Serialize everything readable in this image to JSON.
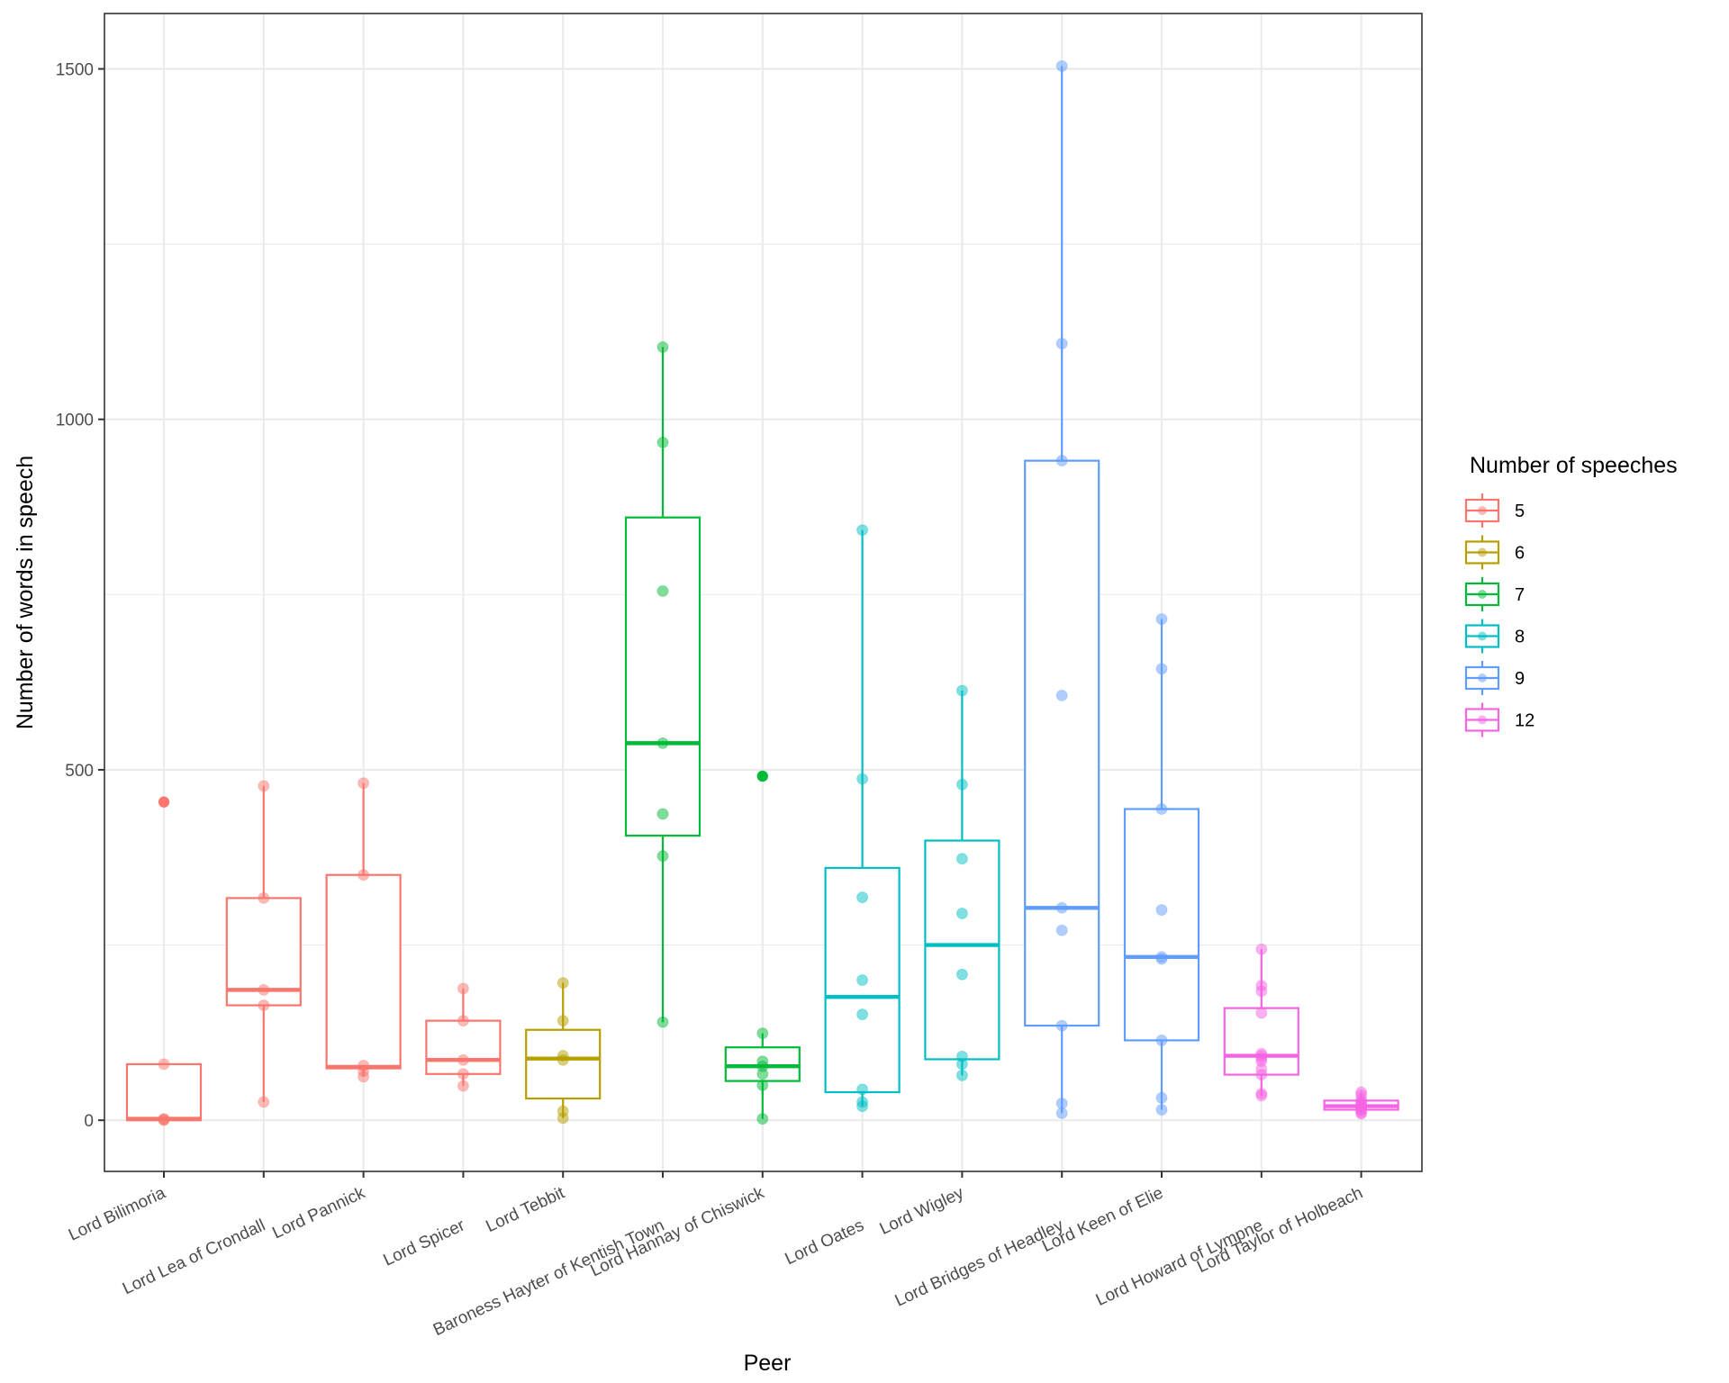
{
  "chart_data": {
    "type": "box",
    "title": "",
    "xlabel": "Peer",
    "ylabel": "Number of words in speech",
    "ylim": [
      -73,
      1579
    ],
    "y_ticks": [
      0,
      500,
      1000,
      1500
    ],
    "y_minor_ticks": [
      250,
      750,
      1250
    ],
    "grid": true,
    "legend": {
      "title": "Number of speeches",
      "placement": "right",
      "entries": [
        {
          "label": "5",
          "color": "#F8766D"
        },
        {
          "label": "6",
          "color": "#B79F00"
        },
        {
          "label": "7",
          "color": "#00BA38"
        },
        {
          "label": "8",
          "color": "#00BFC4"
        },
        {
          "label": "9",
          "color": "#619CFF"
        },
        {
          "label": "12",
          "color": "#F564E3"
        }
      ]
    },
    "categories": [
      "Lord Bilimoria",
      "Lord Lea of Crondall",
      "Lord Pannick",
      "Lord Spicer",
      "Lord Tebbit",
      "Baroness Hayter of Kentish Town",
      "Lord Hannay of Chiswick",
      "Lord Oates",
      "Lord Wigley",
      "Lord Bridges of Headley",
      "Lord Keen of Elie",
      "Lord Howard of Lympne",
      "Lord Taylor of Holbeach"
    ],
    "series": [
      {
        "peer": "Lord Bilimoria",
        "group": "5",
        "min": 0,
        "q1": 0,
        "median": 2,
        "q3": 80,
        "max": 80,
        "outliers": [
          454
        ],
        "points": [
          80,
          2,
          1,
          0,
          454
        ]
      },
      {
        "peer": "Lord Lea of Crondall",
        "group": "5",
        "min": 26,
        "q1": 164,
        "median": 186,
        "q3": 317,
        "max": 477,
        "outliers": [],
        "points": [
          477,
          317,
          186,
          164,
          26
        ]
      },
      {
        "peer": "Lord Pannick",
        "group": "5",
        "min": 62,
        "q1": 74,
        "median": 76,
        "q3": 350,
        "max": 481,
        "outliers": [],
        "points": [
          481,
          350,
          78,
          70,
          62
        ]
      },
      {
        "peer": "Lord Spicer",
        "group": "5",
        "min": 49,
        "q1": 66,
        "median": 86,
        "q3": 142,
        "max": 188,
        "outliers": [],
        "points": [
          188,
          142,
          86,
          66,
          49
        ]
      },
      {
        "peer": "Lord Tebbit",
        "group": "6",
        "min": 3,
        "q1": 31,
        "median": 88,
        "q3": 129,
        "max": 196,
        "outliers": [],
        "points": [
          196,
          142,
          92,
          86,
          13,
          3
        ]
      },
      {
        "peer": "Baroness Hayter of Kentish Town",
        "group": "7",
        "min": 140,
        "q1": 406,
        "median": 538,
        "q3": 860,
        "max": 1103,
        "outliers": [],
        "points": [
          1103,
          967,
          755,
          538,
          437,
          377,
          140
        ]
      },
      {
        "peer": "Lord Hannay of Chiswick",
        "group": "7",
        "min": 2,
        "q1": 56,
        "median": 77,
        "q3": 104,
        "max": 124,
        "outliers": [
          491
        ],
        "points": [
          491,
          124,
          84,
          66,
          50,
          2,
          77
        ]
      },
      {
        "peer": "Lord Oates",
        "group": "8",
        "min": 20,
        "q1": 40,
        "median": 176,
        "q3": 360,
        "max": 842,
        "outliers": [],
        "points": [
          842,
          487,
          318,
          200,
          151,
          44,
          26,
          20
        ]
      },
      {
        "peer": "Lord Wigley",
        "group": "8",
        "min": 64,
        "q1": 87,
        "median": 250,
        "q3": 399,
        "max": 613,
        "outliers": [],
        "points": [
          613,
          479,
          373,
          295,
          208,
          91,
          80,
          64
        ]
      },
      {
        "peer": "Lord Bridges of Headley",
        "group": "9",
        "min": 10,
        "q1": 135,
        "median": 303,
        "q3": 941,
        "max": 1504,
        "outliers": [],
        "points": [
          1504,
          1108,
          941,
          606,
          303,
          271,
          135,
          24,
          10
        ]
      },
      {
        "peer": "Lord Keen of Elie",
        "group": "9",
        "min": 15,
        "q1": 114,
        "median": 233,
        "q3": 444,
        "max": 715,
        "outliers": [],
        "points": [
          715,
          644,
          444,
          300,
          233,
          230,
          114,
          32,
          15
        ]
      },
      {
        "peer": "Lord Howard of Lympne",
        "group": "12",
        "min": 35,
        "q1": 65,
        "median": 92,
        "q3": 160,
        "max": 244,
        "outliers": [],
        "points": [
          244,
          192,
          184,
          153,
          95,
          92,
          88,
          84,
          73,
          65,
          38,
          35
        ]
      },
      {
        "peer": "Lord Taylor of Holbeach",
        "group": "12",
        "min": 9,
        "q1": 15,
        "median": 20,
        "q3": 28,
        "max": 40,
        "outliers": [],
        "points": [
          40,
          36,
          30,
          26,
          24,
          22,
          20,
          18,
          16,
          14,
          11,
          9
        ]
      }
    ]
  }
}
